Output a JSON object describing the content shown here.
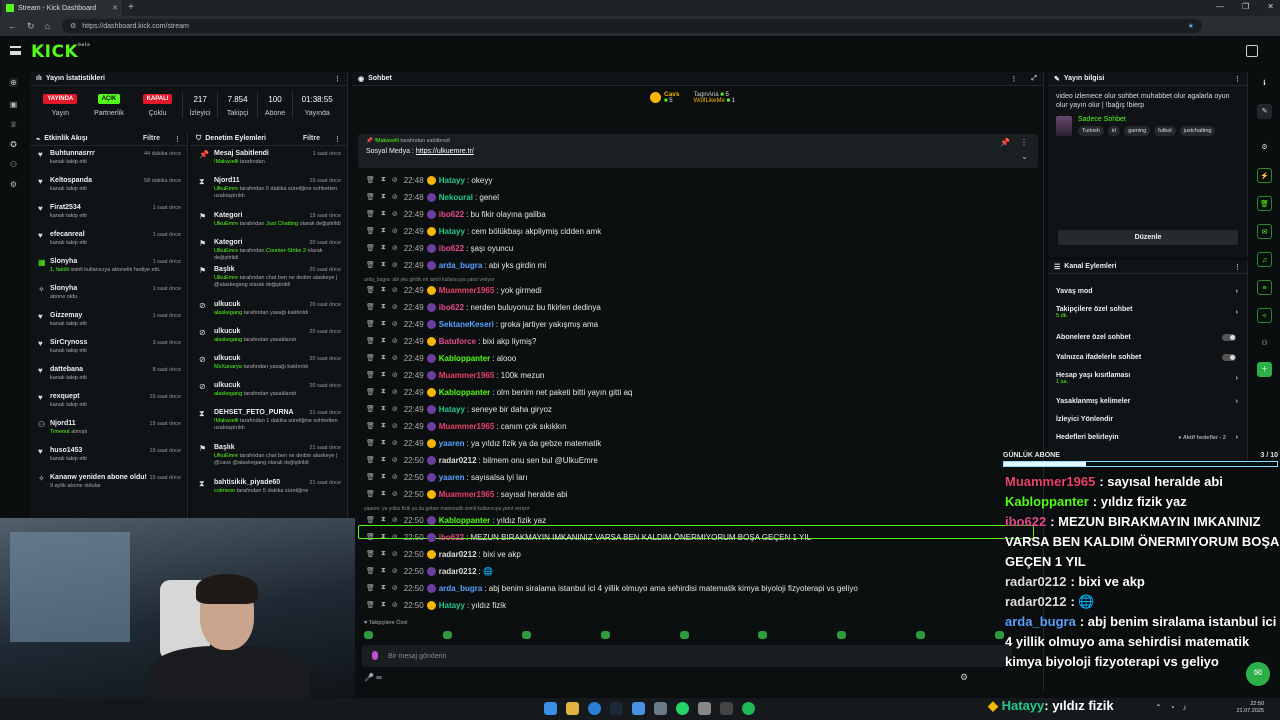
{
  "browser": {
    "tab_title": "Stream - Kick Dashboard",
    "url": "https://dashboard.kick.com/stream"
  },
  "header": {
    "logo": "KICK",
    "logo_sup": "beta"
  },
  "stats": {
    "title": "Yayın İstatistikleri",
    "items": [
      {
        "value": "YAYINDA",
        "label": "Yayın"
      },
      {
        "value": "AÇIK",
        "label": "Partnerlik"
      },
      {
        "value": "KAPALI",
        "label": "Çoklu"
      },
      {
        "value": "217",
        "label": "İzleyici"
      },
      {
        "value": "7.854",
        "label": "Takipçi"
      },
      {
        "value": "100",
        "label": "Abone Sayısı"
      },
      {
        "value": "01:38:55",
        "label": "Yayında Olduğu"
      }
    ]
  },
  "feed": {
    "title": "Etkinlik Akışı",
    "filter": "Filtre",
    "items": [
      {
        "icon": "heart",
        "name": "Buhtunnasrrr",
        "sub": "kanalı takip etti",
        "time": "44 dakika önce"
      },
      {
        "icon": "heart",
        "name": "Keltospanda",
        "sub": "kanalı takip etti",
        "time": "58 dakika önce"
      },
      {
        "icon": "heart",
        "name": "Firat2534",
        "sub": "kanalı takip etti",
        "time": "1 saat önce"
      },
      {
        "icon": "heart",
        "name": "efecanreal",
        "sub": "kanalı takip etti",
        "time": "1 saat önce"
      },
      {
        "icon": "gift",
        "name": "Slonyha",
        "sub_hl": "1, fatolli",
        "sub": "isimli kullanıcıya abonelik hediye etti.",
        "time": "1 saat önce"
      },
      {
        "icon": "star",
        "name": "Slonyha",
        "sub": "abone oldu",
        "time": "1 saat önce"
      },
      {
        "icon": "heart",
        "name": "Gizzemay",
        "sub": "kanalı takip etti",
        "time": "1 saat önce"
      },
      {
        "icon": "heart",
        "name": "SirCrynoss",
        "sub": "kanalı takip etti",
        "time": "3 saat önce"
      },
      {
        "icon": "heart",
        "name": "dattebana",
        "sub": "kanalı takip etti",
        "time": "8 saat önce"
      },
      {
        "icon": "heart",
        "name": "rexquept",
        "sub": "kanalı takip etti",
        "time": "19 saat önce"
      },
      {
        "icon": "users",
        "name": "Njord11",
        "sub": "Timeout",
        "sub2": "almıştı",
        "time": "19 saat önce"
      },
      {
        "icon": "heart",
        "name": "huso1453",
        "sub": "kanalı takip etti",
        "time": "19 saat önce"
      },
      {
        "icon": "star",
        "name": "Kananw yeniden abone oldu!",
        "sub": "9 aylık abone oldular",
        "time": "19 saat önce"
      }
    ]
  },
  "mod": {
    "title": "Denetim Eylemleri",
    "filter": "Filtre",
    "items": [
      {
        "icon": "pin",
        "name": "Mesaj Sabitlendi",
        "user": "!Makavelli",
        "sub": "tarafından",
        "time": "1 saat önce"
      },
      {
        "icon": "hourglass",
        "name": "Njord11",
        "user": "UlkuEmre",
        "sub": "tarafından 5 dakika süreliğine sohbetten uzaklaştırıldı",
        "time": "19 saat önce"
      },
      {
        "icon": "flag",
        "name": "Kategori",
        "user": "UlkuEmre",
        "sub": "tarafından",
        "hl": "Just Chatting",
        "sub3": "olarak değiştirildi",
        "time": "19 saat önce"
      },
      {
        "icon": "flag",
        "name": "Kategori",
        "user": "UlkuEmre",
        "sub": "tarafından",
        "hl": "Counter-Strike 2",
        "sub3": "olarak değiştirildi",
        "time": "20 saat önce"
      },
      {
        "icon": "flag",
        "name": "Başlık",
        "user": "UlkuEmre",
        "sub": "tarafından chat ben ne dedim alaskeye | @alaskegang olarak değiştirildi",
        "time": "20 saat önce"
      },
      {
        "icon": "ban",
        "name": "ulkucuk",
        "user": "alaskegang",
        "sub": "tarafından yasağı kaldırıldı",
        "time": "20 saat önce"
      },
      {
        "icon": "ban",
        "name": "ulkucuk",
        "user": "alaskegang",
        "sub": "tarafından yasaklandı",
        "time": "20 saat önce"
      },
      {
        "icon": "ban",
        "name": "ulkucuk",
        "user": "MsXanarya",
        "sub": "tarafından yasağı kaldırıldı",
        "time": "20 saat önce"
      },
      {
        "icon": "ban",
        "name": "ulkucuk",
        "user": "alaskegang",
        "sub": "tarafından yasaklandı",
        "time": "20 saat önce"
      },
      {
        "icon": "hourglass",
        "name": "DEHSET_FETO_PURNA",
        "user": "!Makavelli",
        "sub": "tarafından 1 dakika süreliğine sohbetten uzaklaştırıldı",
        "time": "21 saat önce"
      },
      {
        "icon": "flag",
        "name": "Başlık",
        "user": "UlkuEmre",
        "sub": "tarafından chat ben ne dedim alaskeye | @cavs @alaskegang olarak değiştirildi",
        "time": "21 saat önce"
      },
      {
        "icon": "hourglass",
        "name": "bahtisikik_piyade60",
        "user": "cotmeon",
        "sub": "tarafından 5 dakika süreliğine",
        "time": "21 saat önce"
      }
    ]
  },
  "chat": {
    "title": "Sohbet",
    "leaderboard": [
      {
        "name": "Cavs",
        "count": "5"
      },
      {
        "name": "TaginAna",
        "count": "5"
      },
      {
        "name": "WolfLikeMe",
        "count": "1"
      }
    ],
    "pinned_by": "!Makavelli",
    "pinned_note": "tarafından sabitlendi",
    "pinned_text": "Sosyal Medya :",
    "pinned_link": "https://ulkuemre.tr/",
    "messages": [
      {
        "time": "22:48",
        "user": "Hatayy",
        "color": "#22c98a",
        "text": ": okeyy"
      },
      {
        "time": "22:48",
        "user": "Nekoural",
        "color": "#22c98a",
        "text": ": genel"
      },
      {
        "time": "22:49",
        "user": "ibo622",
        "color": "#e24a8b",
        "text": ": bu fikir olayına galiba"
      },
      {
        "time": "22:49",
        "user": "Hatayy",
        "color": "#22c98a",
        "text": ": cem bölükbaşı akpliymiş cidden amk"
      },
      {
        "time": "22:49",
        "user": "ibo622",
        "color": "#e24a8b",
        "text": ": şaşı oyuncu"
      },
      {
        "time": "22:49",
        "user": "arda_bugra",
        "color": "#5aa0ff",
        "text": ": abi yks girdin mi"
      },
      {
        "time": "22:49",
        "user": "Muammer1965",
        "color": "#e8416b",
        "text": ": yok girmedi"
      },
      {
        "time": "22:49",
        "user": "ibo622",
        "color": "#e24a8b",
        "text": ": nerden buluyonuz bu fikirlen dedinya"
      },
      {
        "time": "22:49",
        "user": "SektaneKeseri",
        "color": "#5aa0ff",
        "text": ": groka jartiyer yakışmış ama"
      },
      {
        "time": "22:49",
        "user": "Batuforce",
        "color": "#e24a8b",
        "text": ": bixi akp liymiş?"
      },
      {
        "time": "22:49",
        "user": "Kabloppanter",
        "color": "#53fc18",
        "text": ": alooo"
      },
      {
        "time": "22:49",
        "user": "Muammer1965",
        "color": "#e8416b",
        "text": ": 100k mezun"
      },
      {
        "time": "22:49",
        "user": "Kabloppanter",
        "color": "#53fc18",
        "text": ": olm benim net paketi bitti yayın gitti aq"
      },
      {
        "time": "22:49",
        "user": "Hatayy",
        "color": "#22c98a",
        "text": ": seneye bir daha giryoz"
      },
      {
        "time": "22:49",
        "user": "Muammer1965",
        "color": "#e8416b",
        "text": ": canım çok sıkıkkın"
      },
      {
        "time": "22:49",
        "user": "yaaren",
        "color": "#5aa0ff",
        "text": ": ya yıldız fizik ya da gebze matematik"
      },
      {
        "time": "22:50",
        "user": "radar0212",
        "color": "#dddddd",
        "text": ": bilmem onu sen bul @UlkuEmre"
      },
      {
        "time": "22:50",
        "user": "yaaren",
        "color": "#5aa0ff",
        "text": ": sayısalsa iyi ları"
      },
      {
        "time": "22:50",
        "user": "Muammer1965",
        "color": "#e8416b",
        "text": ": sayısal heralde abi"
      },
      {
        "time": "22:50",
        "user": "Kabloppanter",
        "color": "#53fc18",
        "text": ": yıldız fizik yaz"
      },
      {
        "time": "22:50",
        "user": "ibo622",
        "color": "#e24a8b",
        "text": ": MEZUN BIRAKMAYIN IMKANINIZ VARSA BEN KALDIM ÖNERMIYORUM BOŞA GEÇEN 1 YIL"
      },
      {
        "time": "22:50",
        "user": "radar0212",
        "color": "#dddddd",
        "text": ": bixi ve akp"
      },
      {
        "time": "22:50",
        "user": "radar0212",
        "color": "#dddddd",
        "text": ": 🌐"
      },
      {
        "time": "22:50",
        "user": "arda_bugra",
        "color": "#5aa0ff",
        "text": ": abj benim siralama istanbul ici 4 yillik olmuyo ama sehirdisi matematik kimya biyoloji fizyoterapi vs geliyo"
      },
      {
        "time": "22:50",
        "user": "Hatayy",
        "color": "#22c98a",
        "text": ": yıldız fizik"
      }
    ],
    "reply1": "arda_bugra: abi yks girdin mi isimli kullanıcıya yanıt veriyor",
    "reply2": "yaaren: ya yıldız fizik ya da gebze matematik isimli kullanıcıya yanıt veriyor",
    "subonly": "Takipçilere Özel",
    "input_placeholder": "Bir mesaj gönderin",
    "bottom": "🎤 ∞"
  },
  "info": {
    "title": "Yayın bilgisi",
    "stream_title": "video izlemece olur sohbet muhabbet olur agalarla oyun olur yayın olur | !bağış !bierp",
    "category": "Sadece Sohbet",
    "tags": [
      "Turkish",
      "irl",
      "gaming",
      "futbol",
      "justchatting"
    ],
    "edit_button": "Düzenle"
  },
  "actions": {
    "title": "Kanal Eylemleri",
    "items": [
      {
        "label": "Yavaş mod",
        "control": "chevron"
      },
      {
        "label": "Takipçilere özel sohbet",
        "sub": "5 dk.",
        "control": "chevron"
      },
      {
        "label": "Abonelere özel sohbet",
        "control": "toggle"
      },
      {
        "label": "Yalnızca ifadelerle sohbet",
        "control": "toggle"
      },
      {
        "label": "Hesap yaşı kısıtlaması",
        "sub": "1 sa.",
        "control": "chevron"
      },
      {
        "label": "Yasaklanmış kelimeler",
        "control": "chevron"
      },
      {
        "label": "İzleyici Yönlendir",
        "control": "none"
      },
      {
        "label": "Hedefleri belirleyin",
        "control": "chevron"
      }
    ],
    "goal_status": "● Aktif hedefler - 2"
  },
  "overlay": {
    "goal_title": "GÜNLÜK ABONE",
    "goal_count": "3 / 10",
    "goal_progress": 0.3,
    "chat": [
      {
        "user": "Muammer1965",
        "color": "#e8416b",
        "text": ": sayısal heralde abi"
      },
      {
        "user": "Kabloppanter",
        "color": "#53fc18",
        "text": ": yıldız fizik yaz"
      },
      {
        "user": "ibo622",
        "color": "#e24a8b",
        "text": ": MEZUN BIRAKMAYIN IMKANINIZ VARSA BEN KALDIM ÖNERMIYORUM BOŞA GEÇEN 1 YIL"
      },
      {
        "user": "radar0212",
        "color": "#dddddd",
        "text": ": bixi ve akp"
      },
      {
        "user": "radar0212",
        "color": "#dddddd",
        "text": ": 🌐"
      },
      {
        "user": "arda_bugra",
        "color": "#5aa0ff",
        "text": ": abj benim siralama istanbul ici 4 yillik olmuyo ama sehirdisi matematik kimya biyoloji fizyoterapi vs geliyo"
      }
    ],
    "last_user": "Hatayy",
    "last_text": ": yıldız fizik"
  },
  "taskbar": {
    "time": "22:50",
    "date": "21.07.2025"
  }
}
